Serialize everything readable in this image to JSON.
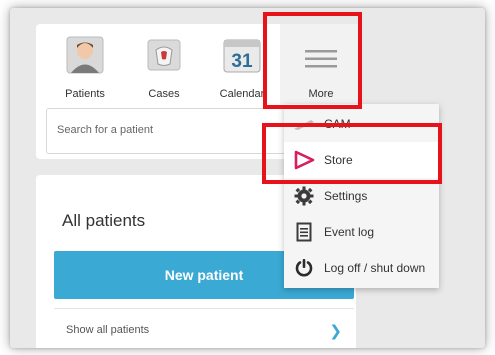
{
  "nav": {
    "tabs": [
      {
        "label": "Patients"
      },
      {
        "label": "Cases"
      },
      {
        "label": "Calendar",
        "day": "31"
      },
      {
        "label": "More"
      }
    ]
  },
  "search": {
    "placeholder": "Search for a patient"
  },
  "patients_panel": {
    "title": "All patients",
    "new_patient_label": "New patient",
    "show_all_label": "Show all patients"
  },
  "more_menu": {
    "items": [
      {
        "label": "CAM",
        "icon": "cam-icon"
      },
      {
        "label": "Store",
        "icon": "store-icon"
      },
      {
        "label": "Settings",
        "icon": "gear-icon"
      },
      {
        "label": "Event log",
        "icon": "document-icon"
      },
      {
        "label": "Log off / shut down",
        "icon": "power-icon"
      }
    ]
  },
  "colors": {
    "accent": "#3aa9d4",
    "highlight": "#e8121a",
    "store": "#d81e5b"
  }
}
